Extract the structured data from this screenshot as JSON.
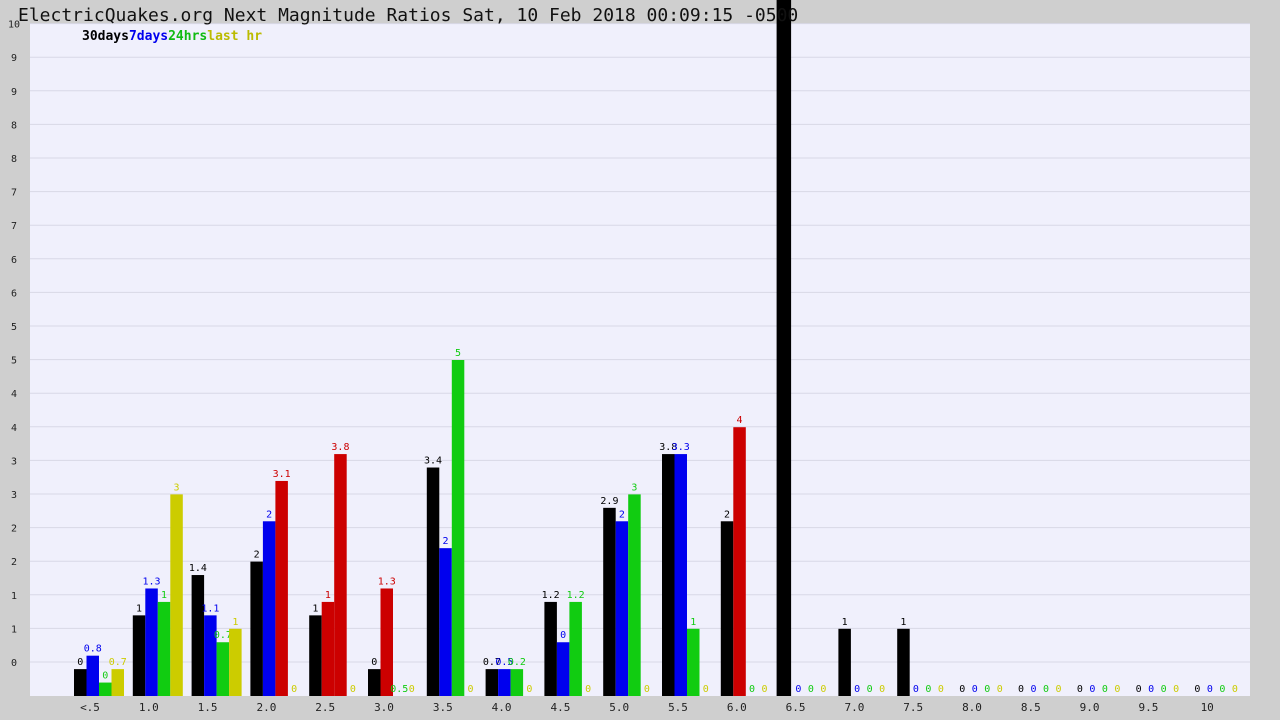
{
  "page": {
    "title": "ElectricQuakes.org Next Magnitude Ratios Sat, 10 Feb 2018 00:09:15 -0500"
  },
  "legend": {
    "items": [
      {
        "label": "30days",
        "color": "#000000"
      },
      {
        "label": "7days",
        "color": "#0000ee"
      },
      {
        "label": "24hrs",
        "color": "#11bb11"
      },
      {
        "label": "last hr",
        "color": "#bbbb00"
      }
    ]
  },
  "colors": {
    "plot_bg": "#f0f0fc",
    "frame_bg": "#cfcfcf",
    "gridline": "#d8d8e6",
    "s30": "#000000",
    "s7": "#0000ee",
    "s24": "#11cc11",
    "s1": "#cccc00",
    "highlight": "#cc0000"
  },
  "chart_data": {
    "type": "bar",
    "title": "ElectricQuakes.org Next Magnitude Ratios Sat, 10 Feb 2018 00:09:15 -0500",
    "categories": [
      "<.5",
      "1.0",
      "1.5",
      "2.0",
      "2.5",
      "3.0",
      "3.5",
      "4.0",
      "4.5",
      "5.0",
      "5.5",
      "6.0",
      "6.5",
      "7.0",
      "7.5",
      "8.0",
      "8.5",
      "9.0",
      "9.5",
      "10"
    ],
    "y_tick_labels": [
      "0",
      "1",
      "1",
      "2",
      "2",
      "3",
      "3",
      "4",
      "4",
      "5",
      "5",
      "6",
      "6",
      "7",
      "7",
      "8",
      "8",
      "9",
      "9",
      "10"
    ],
    "ylim": [
      0,
      10
    ],
    "grid": true,
    "legend_position": "top-left",
    "series": [
      {
        "name": "30days",
        "color": "#000000",
        "values": [
          0.4,
          1.2,
          1.8,
          2.0,
          1.2,
          0.4,
          3.4,
          0.4,
          1.4,
          2.8,
          3.6,
          2.6,
          10.0,
          1.0,
          1.0,
          0,
          0,
          0,
          0,
          0
        ],
        "labels": [
          "0",
          "1",
          "1.4",
          "2",
          "1",
          "0",
          "3.4",
          "0.7",
          "1.2",
          "2.9",
          "3.8",
          "2",
          "",
          "1",
          "1",
          "0",
          "0",
          "0",
          "0",
          "0"
        ]
      },
      {
        "name": "7days",
        "color": "#0000ee",
        "values": [
          0.6,
          1.6,
          1.2,
          2.6,
          1.4,
          1.6,
          2.2,
          0.4,
          0.8,
          2.6,
          3.6,
          0,
          0,
          0,
          0,
          0,
          0,
          0,
          0,
          0
        ],
        "labels": [
          "0.8",
          "1.3",
          "1.1",
          "2",
          "1",
          "1.3",
          "2",
          "0.5",
          "0",
          "2",
          "3.3",
          "",
          "0",
          "0",
          "0",
          "0",
          "0",
          "0",
          "0",
          "0"
        ]
      },
      {
        "name": "24hrs",
        "color": "#11cc11",
        "values": [
          0.2,
          1.4,
          0.8,
          3.2,
          3.6,
          0.0,
          5.0,
          0.4,
          1.4,
          3.0,
          1.0,
          0,
          0,
          0,
          0,
          0,
          0,
          0,
          0,
          0
        ],
        "labels": [
          "0",
          "1",
          "0.7",
          "3.1",
          "3.8",
          "0.5",
          "5",
          "0.2",
          "1.2",
          "3",
          "1",
          "0",
          "0",
          "0",
          "0",
          "0",
          "0",
          "0",
          "0",
          "0"
        ]
      },
      {
        "name": "last hr",
        "color": "#cccc00",
        "values": [
          0.4,
          3.0,
          1.0,
          0,
          0,
          0,
          0,
          0,
          0,
          0,
          0,
          0,
          0,
          0,
          0,
          0,
          0,
          0,
          0,
          0
        ],
        "labels": [
          "0.7",
          "3",
          "1",
          "0",
          "0",
          "0",
          "0",
          "0",
          "0",
          "0",
          "0",
          "0",
          "0",
          "0",
          "0",
          "0",
          "0",
          "0",
          "0",
          "0"
        ]
      }
    ],
    "highlighted_bars": [
      {
        "category": "2.0",
        "series": "24hrs",
        "color": "#cc0000"
      },
      {
        "category": "2.5",
        "series": "7days",
        "color": "#cc0000"
      },
      {
        "category": "2.5",
        "series": "24hrs",
        "color": "#cc0000"
      },
      {
        "category": "3.0",
        "series": "7days",
        "color": "#cc0000"
      },
      {
        "category": "6.0",
        "series": "7days",
        "value": 4.0,
        "label": "4",
        "color": "#cc0000"
      }
    ]
  }
}
